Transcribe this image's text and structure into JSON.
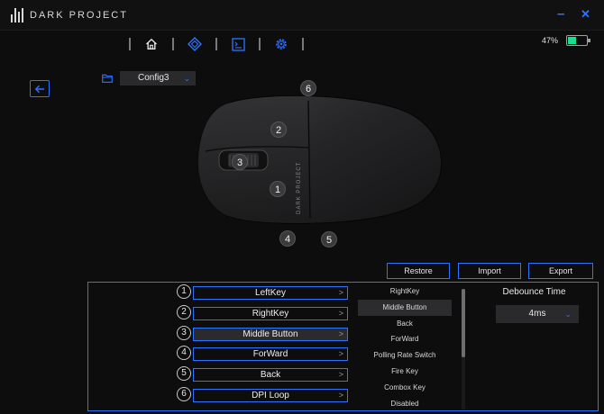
{
  "app": {
    "brand": "DARK PROJECT",
    "accent": "#2e73ff",
    "battery_color": "#19e08c"
  },
  "window_controls": {
    "minimize": "–",
    "close": "✕"
  },
  "nav": [
    "home-icon",
    "diamond-icon",
    "console-icon",
    "gear-icon"
  ],
  "battery": {
    "percent_label": "47%",
    "level": 0.47
  },
  "config": {
    "selected": "Config3"
  },
  "mouse_badges": [
    "1",
    "2",
    "3",
    "4",
    "5",
    "6"
  ],
  "mouse_logo": "DARK PROJECT",
  "actions": {
    "restore": "Restore",
    "import": "Import",
    "export": "Export"
  },
  "key_assignments": [
    {
      "num": "1",
      "label": "LeftKey"
    },
    {
      "num": "2",
      "label": "RightKey"
    },
    {
      "num": "3",
      "label": "Middle Button"
    },
    {
      "num": "4",
      "label": "ForWard"
    },
    {
      "num": "5",
      "label": "Back"
    },
    {
      "num": "6",
      "label": "DPI Loop"
    }
  ],
  "function_list": [
    "RightKey",
    "Middle Button",
    "Back",
    "ForWard",
    "Polling Rate Switch",
    "Fire Key",
    "Combox Key",
    "Disabled"
  ],
  "debounce": {
    "title": "Debounce Time",
    "value": "4ms"
  }
}
